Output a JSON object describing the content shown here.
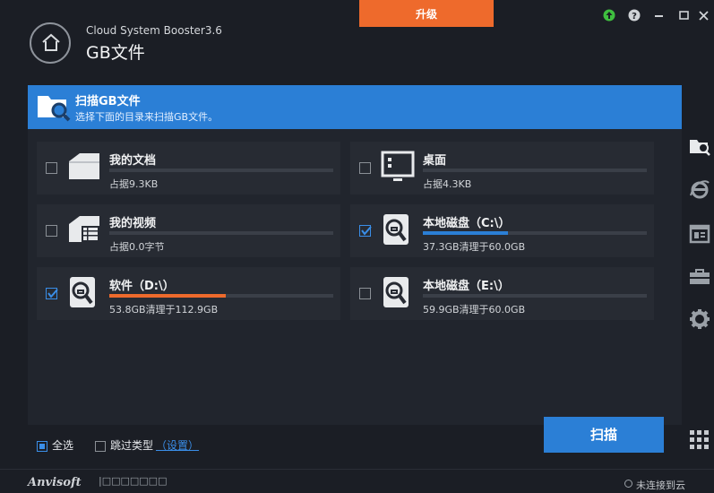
{
  "app": {
    "name": "Cloud System Booster3.6",
    "page_title": "GB文件",
    "upgrade_label": "升级"
  },
  "banner": {
    "title": "扫描GB文件",
    "subtitle": "选择下面的目录来扫描GB文件。"
  },
  "items": [
    {
      "name": "我的文档",
      "detail": "占据9.3KB",
      "checked": false,
      "icon": "folder-icon",
      "progress": 0
    },
    {
      "name": "桌面",
      "detail": "占据4.3KB",
      "checked": false,
      "icon": "desktop-icon",
      "progress": 0
    },
    {
      "name": "我的视频",
      "detail": "占据0.0字节",
      "checked": false,
      "icon": "video-folder-icon",
      "progress": 0
    },
    {
      "name": "本地磁盘（C:\\）",
      "detail": "37.3GB清理于60.0GB",
      "checked": true,
      "icon": "disk-search-icon",
      "progress": 0.38
    },
    {
      "name": "软件（D:\\）",
      "detail": "53.8GB清理于112.9GB",
      "checked": true,
      "icon": "disk-search-icon",
      "progress": 0.52
    },
    {
      "name": "本地磁盘（E:\\）",
      "detail": "59.9GB清理于60.0GB",
      "checked": false,
      "icon": "disk-search-icon",
      "progress": 0
    }
  ],
  "footer": {
    "select_all": "全选",
    "skip_types": "跳过类型",
    "settings_link": "（设置）",
    "scan_button": "扫描",
    "logo": "Anvisoft",
    "boxes": "|□□□□□□□",
    "status": "未连接到云"
  },
  "colors": {
    "accent": "#2b7fd6",
    "upgrade": "#ee6a2c",
    "progress_c": "#2b7fd6",
    "progress_d": "#ee6a2c"
  },
  "sidebar_icons": [
    "scan-folder-icon",
    "ie-icon",
    "window-icon",
    "toolbox-icon",
    "gear-icon"
  ]
}
